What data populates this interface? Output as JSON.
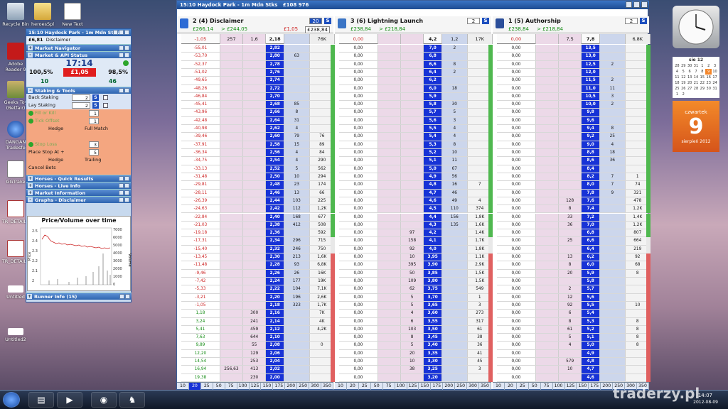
{
  "desktop": {
    "icons": [
      {
        "label": "Recycle Bin"
      },
      {
        "label": "heroesSpl"
      },
      {
        "label": "New Text"
      },
      {
        "label": "Adobe Reader 9"
      },
      {
        "label": "Geeks Toy (Betfair)"
      },
      {
        "label": "DANGAN Tradesfe"
      },
      {
        "label": "GGTrake"
      },
      {
        "label": "TR_DETAILS"
      },
      {
        "label": "TR_DETAILS"
      },
      {
        "label": "Untitled"
      },
      {
        "label": "Untitled2"
      }
    ]
  },
  "nav": {
    "title": "15:10 Haydock Park - 1m Mdn Stks",
    "sub_price": "£6,81",
    "sub_name": "Disclaimer",
    "sections": {
      "navigator": "Market Navigator",
      "status": "Market & API Status",
      "staking": "Staking & Tools",
      "quick": "Horses - Quick Results",
      "live": "Horses - Live Info",
      "info": "Market Information",
      "graphs": "Graphs - Disclaimer",
      "runner": "Runner Info (15)"
    },
    "status": {
      "time": "17:14",
      "red": "£1,05",
      "left": "100,5%",
      "right": "98,5%",
      "c1": "10",
      "c2": "46"
    },
    "staking": {
      "back_label": "Back Staking",
      "back_val": "2",
      "lay_label": "Lay Staking",
      "lay_val": "2",
      "s": "S",
      "fill": "Fill or Kill",
      "fill_val": "1",
      "tick": "Tick Offset",
      "tick_val": "1",
      "hedge": "Hedge",
      "full": "Full Match",
      "stop": "Stop Loss",
      "stop_val": "3",
      "place": "Place Stop At +",
      "place_val": "5",
      "hedge2": "Hedge",
      "trailing": "Trailing",
      "cancel": "Cancel Bets"
    },
    "chart": {
      "title": "Price/Volume over time",
      "ylabel": "Price",
      "y2label": "Volume",
      "yticks": [
        "2.5",
        "2.4",
        "2.3",
        "2.2",
        "2.1",
        "2"
      ],
      "y2ticks": [
        "7000",
        "6000",
        "5000",
        "4000",
        "3000",
        "2000",
        "1000",
        "0"
      ]
    }
  },
  "ladder": {
    "title": "15:10 Haydock Park - 1m Mdn Stks",
    "matched": "£108 976",
    "runners": [
      {
        "name": "2  (4) Disclaimer",
        "sub1": "£266,14",
        "sub2": "> £244,05",
        "sub3": "£1,05",
        "sub4": "£238,84",
        "box": "20",
        "s": "S",
        "hdr": [
          "-1,05",
          "257",
          "1,6",
          "2,18",
          "",
          "76K"
        ]
      },
      {
        "name": "3  (6) Lightning Launch",
        "sub1": "£238,84",
        "sub2": "> £218,84",
        "box": "2",
        "s": "S",
        "hdr": [
          "0,00",
          "",
          "",
          "4,2",
          "1,2",
          "17K"
        ]
      },
      {
        "name": "1  (5) Authorship",
        "sub1": "£238,84",
        "sub2": "> £218,84",
        "box": "2",
        "s": "S",
        "hdr": [
          "0,00",
          "",
          "7,5",
          "7,8",
          "",
          "6,8K"
        ]
      }
    ],
    "scroll": [
      "10",
      "20",
      "25",
      "50",
      "75",
      "100",
      "125",
      "150",
      "175",
      "200",
      "250",
      "300",
      "350"
    ]
  },
  "ladder_rows": {
    "r1": [
      [
        "-55,01",
        "",
        "",
        "2,82",
        "",
        ""
      ],
      [
        "-53,70",
        "",
        "",
        "2,80",
        "63",
        ""
      ],
      [
        "-52,37",
        "",
        "",
        "2,78",
        "",
        ""
      ],
      [
        "-51,02",
        "",
        "",
        "2,76",
        "",
        ""
      ],
      [
        "-49,65",
        "",
        "",
        "2,74",
        "",
        ""
      ],
      [
        "-48,26",
        "",
        "",
        "2,72",
        "",
        ""
      ],
      [
        "-46,84",
        "",
        "",
        "2,70",
        "",
        ""
      ],
      [
        "-45,41",
        "",
        "",
        "2,68",
        "85",
        ""
      ],
      [
        "-43,96",
        "",
        "",
        "2,66",
        "8",
        ""
      ],
      [
        "-42,48",
        "",
        "",
        "2,64",
        "31",
        ""
      ],
      [
        "-40,98",
        "",
        "",
        "2,62",
        "4",
        ""
      ],
      [
        "-39,46",
        "",
        "",
        "2,60",
        "79",
        "76"
      ],
      [
        "-37,91",
        "",
        "",
        "2,58",
        "15",
        "89"
      ],
      [
        "-36,34",
        "",
        "",
        "2,56",
        "4",
        "84"
      ],
      [
        "-34,75",
        "",
        "",
        "2,54",
        "4",
        "290"
      ],
      [
        "-33,13",
        "",
        "",
        "2,52",
        "5",
        "562"
      ],
      [
        "-31,48",
        "",
        "",
        "2,50",
        "10",
        "294"
      ],
      [
        "-29,81",
        "",
        "",
        "2,48",
        "23",
        "174"
      ],
      [
        "-28,11",
        "",
        "",
        "2,46",
        "13",
        "66"
      ],
      [
        "-26,39",
        "",
        "",
        "2,44",
        "103",
        "225"
      ],
      [
        "-24,63",
        "",
        "",
        "2,42",
        "112",
        "1,2K"
      ],
      [
        "-22,84",
        "",
        "",
        "2,40",
        "168",
        "677"
      ],
      [
        "-21,03",
        "",
        "",
        "2,38",
        "412",
        "508"
      ],
      [
        "-19,18",
        "",
        "",
        "2,36",
        "",
        "592"
      ],
      [
        "-17,31",
        "",
        "",
        "2,34",
        "296",
        "715"
      ],
      [
        "-15,40",
        "",
        "",
        "2,32",
        "246",
        "750"
      ],
      [
        "-13,45",
        "",
        "",
        "2,30",
        "213",
        "1,6K"
      ],
      [
        "-11,48",
        "",
        "",
        "2,28",
        "93",
        "6,8K"
      ],
      [
        "-9,46",
        "",
        "",
        "2,26",
        "26",
        "16K"
      ],
      [
        "-7,42",
        "",
        "",
        "2,24",
        "177",
        "19K"
      ],
      [
        "-5,33",
        "",
        "",
        "2,22",
        "104",
        "7,1K"
      ],
      [
        "-3,21",
        "",
        "",
        "2,20",
        "196",
        "2,6K"
      ],
      [
        "-1,05",
        "",
        "",
        "2,18",
        "323",
        "1,7K"
      ],
      [
        "1,18",
        "",
        "300",
        "2,16",
        "",
        "7K"
      ],
      [
        "3,24",
        "",
        "241",
        "2,14",
        "",
        "4K"
      ],
      [
        "5,41",
        "",
        "459",
        "2,12",
        "",
        "4,2K"
      ],
      [
        "7,63",
        "",
        "644",
        "2,10",
        "",
        ""
      ],
      [
        "9,89",
        "",
        "55",
        "2,08",
        "",
        "0"
      ],
      [
        "12,20",
        "",
        "129",
        "2,06",
        "",
        ""
      ],
      [
        "14,54",
        "",
        "253",
        "2,04",
        "",
        ""
      ],
      [
        "16,94",
        "256,63",
        "413",
        "2,02",
        "",
        ""
      ],
      [
        "19,38",
        "",
        "230",
        "2,00",
        "",
        ""
      ]
    ],
    "r2": [
      [
        "0,00",
        "",
        "",
        "7,0",
        "2",
        ""
      ],
      [
        "0,00",
        "",
        "",
        "6,8",
        "",
        ""
      ],
      [
        "0,00",
        "",
        "",
        "6,6",
        "8",
        ""
      ],
      [
        "0,00",
        "",
        "",
        "6,4",
        "2",
        ""
      ],
      [
        "0,00",
        "",
        "",
        "6,2",
        "",
        ""
      ],
      [
        "0,00",
        "",
        "",
        "6,0",
        "18",
        ""
      ],
      [
        "0,00",
        "",
        "",
        "5,9",
        "",
        ""
      ],
      [
        "0,00",
        "",
        "",
        "5,8",
        "30",
        ""
      ],
      [
        "0,00",
        "",
        "",
        "5,7",
        "5",
        ""
      ],
      [
        "0,00",
        "",
        "",
        "5,6",
        "3",
        ""
      ],
      [
        "0,00",
        "",
        "",
        "5,5",
        "4",
        ""
      ],
      [
        "0,00",
        "",
        "",
        "5,4",
        "4",
        ""
      ],
      [
        "0,00",
        "",
        "",
        "5,3",
        "8",
        ""
      ],
      [
        "0,00",
        "",
        "",
        "5,2",
        "10",
        ""
      ],
      [
        "0,00",
        "",
        "",
        "5,1",
        "11",
        ""
      ],
      [
        "0,00",
        "",
        "",
        "5,0",
        "67",
        ""
      ],
      [
        "0,00",
        "",
        "",
        "4,9",
        "56",
        ""
      ],
      [
        "0,00",
        "",
        "",
        "4,8",
        "16",
        "7"
      ],
      [
        "0,00",
        "",
        "",
        "4,7",
        "46",
        ""
      ],
      [
        "0,00",
        "",
        "",
        "4,6",
        "49",
        "4"
      ],
      [
        "0,00",
        "",
        "",
        "4,5",
        "110",
        "374"
      ],
      [
        "0,00",
        "",
        "",
        "4,4",
        "156",
        "1,8K"
      ],
      [
        "0,00",
        "",
        "",
        "4,3",
        "135",
        "1,6K"
      ],
      [
        "0,00",
        "",
        "97",
        "4,2",
        "",
        "1,4K"
      ],
      [
        "0,00",
        "",
        "158",
        "4,1",
        "",
        "1,7K"
      ],
      [
        "0,00",
        "",
        "92",
        "4,0",
        "",
        "1,8K"
      ],
      [
        "0,00",
        "",
        "10",
        "3,95",
        "",
        "1,1K"
      ],
      [
        "0,00",
        "",
        "395",
        "3,90",
        "",
        "2,9K"
      ],
      [
        "0,00",
        "",
        "50",
        "3,85",
        "",
        "1,5K"
      ],
      [
        "0,00",
        "",
        "109",
        "3,80",
        "",
        "1,5K"
      ],
      [
        "0,00",
        "",
        "62",
        "3,75",
        "",
        "549"
      ],
      [
        "0,00",
        "",
        "5",
        "3,70",
        "",
        "1"
      ],
      [
        "0,00",
        "",
        "5",
        "3,65",
        "",
        "3"
      ],
      [
        "0,00",
        "",
        "4",
        "3,60",
        "",
        "273"
      ],
      [
        "0,00",
        "",
        "6",
        "3,55",
        "",
        "317"
      ],
      [
        "0,00",
        "",
        "103",
        "3,50",
        "",
        "61"
      ],
      [
        "0,00",
        "",
        "8",
        "3,45",
        "",
        "38"
      ],
      [
        "0,00",
        "",
        "5",
        "3,40",
        "",
        "36"
      ],
      [
        "0,00",
        "",
        "20",
        "3,35",
        "",
        "41"
      ],
      [
        "0,00",
        "",
        "10",
        "3,30",
        "",
        "45"
      ],
      [
        "0,00",
        "",
        "38",
        "3,25",
        "",
        "3"
      ],
      [
        "0,00",
        "",
        "",
        "3,20",
        "",
        ""
      ]
    ],
    "r3": [
      [
        "0,00",
        "",
        "",
        "13,5",
        "",
        ""
      ],
      [
        "0,00",
        "",
        "",
        "13,0",
        "",
        ""
      ],
      [
        "0,00",
        "",
        "",
        "12,5",
        "2",
        ""
      ],
      [
        "0,00",
        "",
        "",
        "12,0",
        "",
        ""
      ],
      [
        "0,00",
        "",
        "",
        "11,5",
        "2",
        ""
      ],
      [
        "0,00",
        "",
        "",
        "11,0",
        "11",
        ""
      ],
      [
        "0,00",
        "",
        "",
        "10,5",
        "3",
        ""
      ],
      [
        "0,00",
        "",
        "",
        "10,0",
        "2",
        ""
      ],
      [
        "0,00",
        "",
        "",
        "9,8",
        "",
        ""
      ],
      [
        "0,00",
        "",
        "",
        "9,6",
        "",
        ""
      ],
      [
        "0,00",
        "",
        "",
        "9,4",
        "8",
        ""
      ],
      [
        "0,00",
        "",
        "",
        "9,2",
        "25",
        ""
      ],
      [
        "0,00",
        "",
        "",
        "9,0",
        "4",
        ""
      ],
      [
        "0,00",
        "",
        "",
        "8,8",
        "18",
        ""
      ],
      [
        "0,00",
        "",
        "",
        "8,6",
        "36",
        ""
      ],
      [
        "0,00",
        "",
        "",
        "8,4",
        "",
        ""
      ],
      [
        "0,00",
        "",
        "",
        "8,2",
        "7",
        "1"
      ],
      [
        "0,00",
        "",
        "",
        "8,0",
        "7",
        "74"
      ],
      [
        "0,00",
        "",
        "",
        "7,8",
        "9",
        "321"
      ],
      [
        "0,00",
        "",
        "128",
        "7,6",
        "",
        "478"
      ],
      [
        "0,00",
        "",
        "8",
        "7,4",
        "",
        "1,2K"
      ],
      [
        "0,00",
        "",
        "33",
        "7,2",
        "",
        "1,4K"
      ],
      [
        "0,00",
        "",
        "36",
        "7,0",
        "",
        "1,2K"
      ],
      [
        "0,00",
        "",
        "",
        "6,8",
        "",
        "807"
      ],
      [
        "0,00",
        "",
        "25",
        "6,6",
        "",
        "664"
      ],
      [
        "0,00",
        "",
        "",
        "6,4",
        "",
        "219"
      ],
      [
        "0,00",
        "",
        "13",
        "6,2",
        "",
        "92"
      ],
      [
        "0,00",
        "",
        "8",
        "6,0",
        "",
        "68"
      ],
      [
        "0,00",
        "",
        "20",
        "5,9",
        "",
        "8"
      ],
      [
        "0,00",
        "",
        "",
        "5,8",
        "",
        ""
      ],
      [
        "0,00",
        "",
        "2",
        "5,7",
        "",
        ""
      ],
      [
        "0,00",
        "",
        "12",
        "5,6",
        "",
        ""
      ],
      [
        "0,00",
        "",
        "92",
        "5,5",
        "",
        "10"
      ],
      [
        "0,00",
        "",
        "6",
        "5,4",
        "",
        ""
      ],
      [
        "0,00",
        "",
        "8",
        "5,3",
        "",
        "8"
      ],
      [
        "0,00",
        "",
        "61",
        "5,2",
        "",
        "8"
      ],
      [
        "0,00",
        "",
        "5",
        "5,1",
        "",
        "8"
      ],
      [
        "0,00",
        "",
        "4",
        "5,0",
        "",
        "8"
      ],
      [
        "0,00",
        "",
        "",
        "4,9",
        "",
        ""
      ],
      [
        "0,00",
        "",
        "579",
        "4,8",
        "",
        ""
      ],
      [
        "0,00",
        "",
        "10",
        "4,7",
        "",
        ""
      ],
      [
        "0,00",
        "",
        "",
        "4,6",
        "",
        ""
      ]
    ]
  },
  "clock": {
    "month": "sie 12",
    "day_name": "czwartek",
    "day": "9",
    "month_full": "sierpień 2012",
    "cal_days": [
      "28",
      "29",
      "30",
      "31",
      "1",
      "2",
      "3",
      "4",
      "5",
      "6",
      "7",
      "8",
      "9",
      "10",
      "11",
      "12",
      "13",
      "14",
      "15",
      "16",
      "17",
      "18",
      "19",
      "20",
      "21",
      "22",
      "23",
      "24",
      "25",
      "26",
      "27",
      "28",
      "29",
      "30",
      "31",
      "1",
      "2"
    ]
  },
  "taskbar": {
    "time": "14:07",
    "date": "2012-08-09",
    "watermark": "traderzy.pl"
  },
  "colors": {
    "accent": "#1732d6",
    "green": "#118a11",
    "red": "#cc2222"
  }
}
